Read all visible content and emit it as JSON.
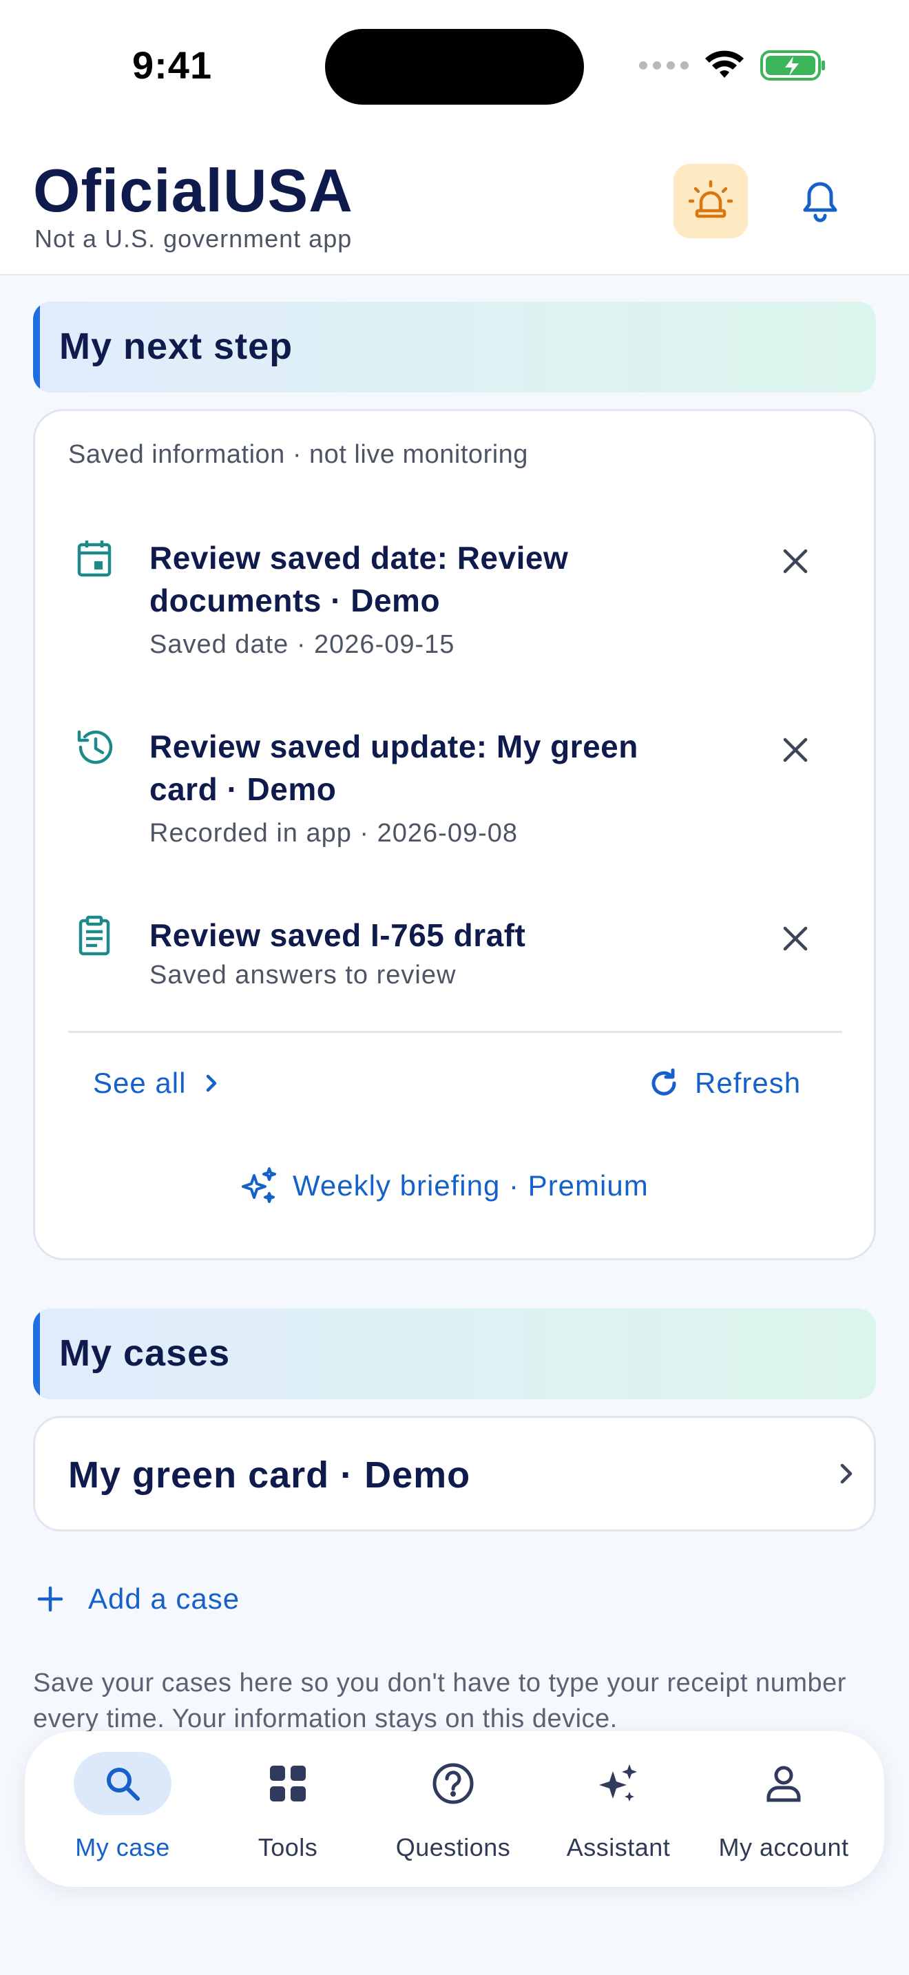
{
  "status_bar": {
    "time": "9:41"
  },
  "header": {
    "title": "OficialUSA",
    "subtitle": "Not a U.S. government app",
    "alert_icon": "siren-icon",
    "notification_icon": "bell-icon"
  },
  "next_step": {
    "section_title": "My next step",
    "note": "Saved information · not live monitoring",
    "tasks": [
      {
        "icon": "calendar-icon",
        "title": "Review saved date: Review documents · Demo",
        "subtitle": "Saved date · 2026-09-15"
      },
      {
        "icon": "history-icon",
        "title": "Review saved update: My green card · Demo",
        "subtitle": "Recorded in app · 2026-09-08"
      },
      {
        "icon": "clipboard-icon",
        "title": "Review saved I-765 draft",
        "subtitle": "Saved answers to review"
      }
    ],
    "see_all": "See all",
    "refresh": "Refresh",
    "weekly_briefing": "Weekly briefing · Premium"
  },
  "cases": {
    "section_title": "My cases",
    "items": [
      {
        "label": "My green card · Demo"
      }
    ],
    "add_case": "Add a case",
    "help_text": "Save your cases here so you don't have to type your receipt number every time. Your information stays on this device."
  },
  "tab_bar": {
    "tabs": [
      {
        "label": "My case",
        "icon": "search-icon",
        "active": true
      },
      {
        "label": "Tools",
        "icon": "grid-icon",
        "active": false
      },
      {
        "label": "Questions",
        "icon": "question-icon",
        "active": false
      },
      {
        "label": "Assistant",
        "icon": "sparkle-icon",
        "active": false
      },
      {
        "label": "My account",
        "icon": "person-icon",
        "active": false
      }
    ]
  },
  "colors": {
    "accent": "#1560c9",
    "title": "#0f1b4d",
    "teal_icon": "#1c8a8a",
    "alert_bg": "#fde9c2",
    "alert_icon": "#d9760f"
  }
}
